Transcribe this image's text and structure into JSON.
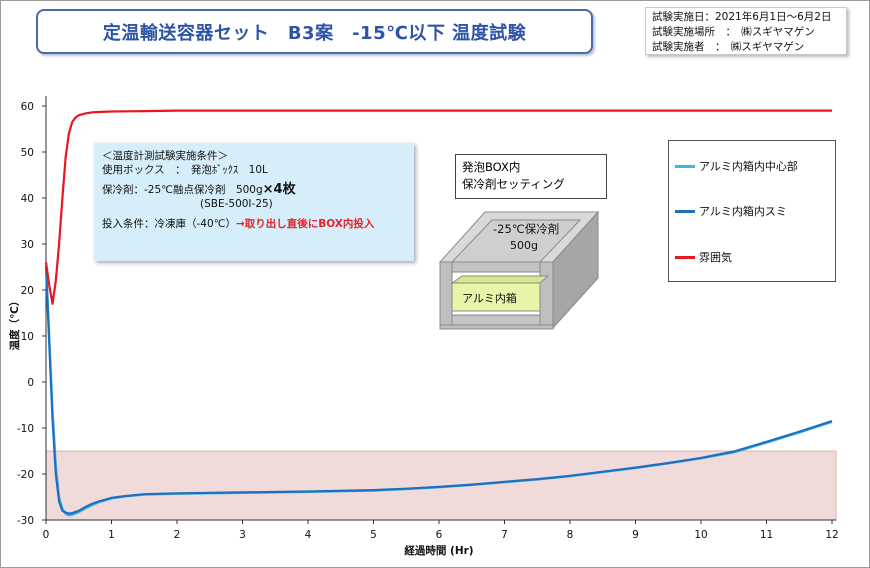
{
  "header": {
    "title": "定温輸送容器セット　B3案　-15℃以下 温度試験"
  },
  "test_info": {
    "date": "試験実施日：2021年6月1日～6月2日",
    "place": "試験実施場所　：　㈱スギヤマゲン",
    "person": "試験実施者　：　㈱スギヤマゲン"
  },
  "conditions": {
    "heading": "＜温度計測試験実施条件＞",
    "box": "使用ボックス　：　発泡ﾎﾞｯｸｽ　10L",
    "coolant_prefix": "保冷剤：-25℃融点保冷剤　500g",
    "coolant_count": "×4枚",
    "coolant_model": "(SBE-500I-25)",
    "input_prefix": "投入条件：冷凍庫（-40℃）",
    "input_highlight": "→取り出し直後にBOX内投入"
  },
  "setting": {
    "line1": "発泡BOX内",
    "line2": "保冷剤セッティング",
    "coolant_label": "-25℃保冷剤",
    "coolant_weight": "500g",
    "inner_box_label": "アルミ内箱"
  },
  "colors": {
    "center": "#3fb6e6",
    "corner": "#1f6fc0",
    "ambient": "#e8161e",
    "band": "#f1dada"
  },
  "chart_data": {
    "type": "line",
    "title": "定温輸送容器セット　B3案　-15℃以下 温度試験",
    "xlabel": "経過時間 (Hr)",
    "ylabel": "温度（℃）",
    "xlim": [
      0,
      12
    ],
    "ylim": [
      -30,
      60
    ],
    "xticks": [
      0,
      1,
      2,
      3,
      4,
      5,
      6,
      7,
      8,
      9,
      10,
      11,
      12
    ],
    "yticks": [
      -30,
      -20,
      -10,
      0,
      10,
      20,
      30,
      40,
      50,
      60
    ],
    "grid": false,
    "legend_position": "right",
    "highlight_band": [
      -30,
      -15
    ],
    "series": [
      {
        "name": "アルミ内箱内中心部",
        "color": "#3fb6e6",
        "x": [
          0,
          0.05,
          0.1,
          0.15,
          0.2,
          0.25,
          0.3,
          0.35,
          0.4,
          0.5,
          0.6,
          0.7,
          0.8,
          1.0,
          1.2,
          1.5,
          2,
          3,
          4,
          5,
          5.5,
          6,
          6.5,
          7,
          7.5,
          8,
          8.5,
          9,
          9.5,
          10,
          10.5,
          11,
          11.5,
          12
        ],
        "y": [
          26,
          10,
          -6,
          -18,
          -25,
          -27.5,
          -28.7,
          -29.0,
          -28.9,
          -28.3,
          -27.5,
          -26.8,
          -26.2,
          -25.3,
          -24.9,
          -24.5,
          -24.3,
          -24.1,
          -23.9,
          -23.6,
          -23.3,
          -22.9,
          -22.4,
          -21.8,
          -21.2,
          -20.5,
          -19.6,
          -18.7,
          -17.7,
          -16.6,
          -15.3,
          -13.2,
          -11.0,
          -8.7
        ]
      },
      {
        "name": "アルミ内箱内スミ",
        "color": "#1f6fc0",
        "x": [
          0,
          0.05,
          0.1,
          0.15,
          0.2,
          0.25,
          0.3,
          0.35,
          0.4,
          0.5,
          0.6,
          0.7,
          0.8,
          1.0,
          1.2,
          1.5,
          2,
          3,
          4,
          5,
          5.5,
          6,
          6.5,
          7,
          7.5,
          8,
          8.5,
          9,
          9.5,
          10,
          10.5,
          11,
          11.5,
          12
        ],
        "y": [
          25,
          8,
          -8,
          -20,
          -26,
          -28,
          -28.4,
          -28.6,
          -28.5,
          -28.0,
          -27.2,
          -26.5,
          -26.0,
          -25.2,
          -24.8,
          -24.4,
          -24.2,
          -24.0,
          -23.8,
          -23.5,
          -23.2,
          -22.8,
          -22.3,
          -21.7,
          -21.1,
          -20.4,
          -19.5,
          -18.6,
          -17.6,
          -16.5,
          -15.1,
          -13.0,
          -10.8,
          -8.5
        ]
      },
      {
        "name": "雰囲気",
        "color": "#e8161e",
        "x": [
          0,
          0.05,
          0.1,
          0.15,
          0.2,
          0.25,
          0.3,
          0.35,
          0.4,
          0.45,
          0.5,
          0.6,
          0.7,
          0.8,
          1.0,
          1.5,
          2,
          3,
          4,
          5,
          6,
          7,
          8,
          9,
          10,
          11,
          12
        ],
        "y": [
          26,
          21,
          17,
          22,
          30,
          40,
          49,
          54,
          56.5,
          57.5,
          58.0,
          58.4,
          58.6,
          58.7,
          58.8,
          58.9,
          59.0,
          59.0,
          59.0,
          59.0,
          59.0,
          59.0,
          59.0,
          59.0,
          59.0,
          59.0,
          59.0
        ]
      }
    ]
  }
}
